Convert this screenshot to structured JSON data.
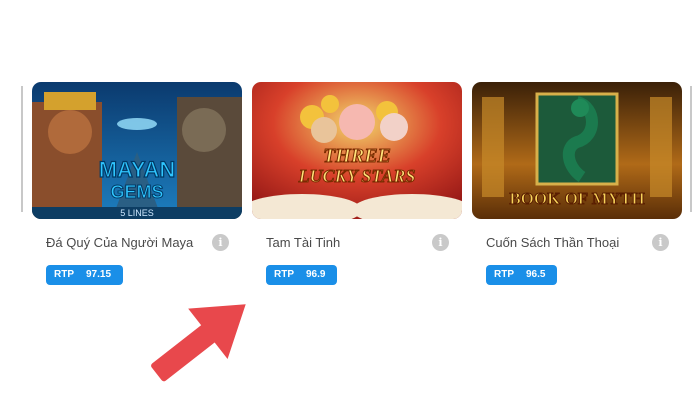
{
  "games": [
    {
      "title": "Đá Quý Của Người Maya",
      "rtp_label": "RTP",
      "rtp_value": "97.15",
      "art_text_1": "MAYAN",
      "art_text_2": "GEMS",
      "art_sub": "5 LINES"
    },
    {
      "title": "Tam Tài Tinh",
      "rtp_label": "RTP",
      "rtp_value": "96.9",
      "art_text_1": "THREE",
      "art_text_2": "LUCKY STARS",
      "art_sub": ""
    },
    {
      "title": "Cuốn Sách Thần Thoại",
      "rtp_label": "RTP",
      "rtp_value": "96.5",
      "art_text_1": "BOOK OF MYTH",
      "art_text_2": "",
      "art_sub": ""
    }
  ],
  "icons": {
    "info": "info-icon",
    "arrow": "arrow-pointer"
  },
  "colors": {
    "badge": "#1a8fe8",
    "arrow": "#e8484c",
    "title_text": "#4a4a4a"
  }
}
